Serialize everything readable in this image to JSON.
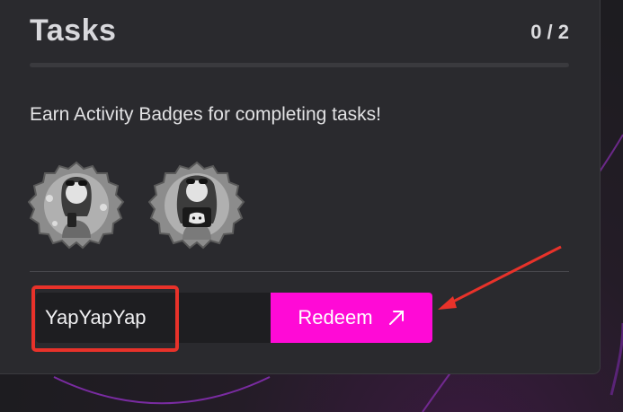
{
  "tasks": {
    "title": "Tasks",
    "counter": "0 / 2",
    "completed": 0,
    "total": 2,
    "description": "Earn Activity Badges for completing tasks!",
    "badges": [
      {
        "icon": "twitter-user-badge-icon"
      },
      {
        "icon": "discord-user-badge-icon"
      }
    ]
  },
  "redeem": {
    "code_value": "YapYapYap",
    "button_label": "Redeem",
    "button_icon": "arrow-up-right-icon",
    "button_color": "#ff0ad6"
  },
  "annotation": {
    "box_color": "#e8322a"
  }
}
